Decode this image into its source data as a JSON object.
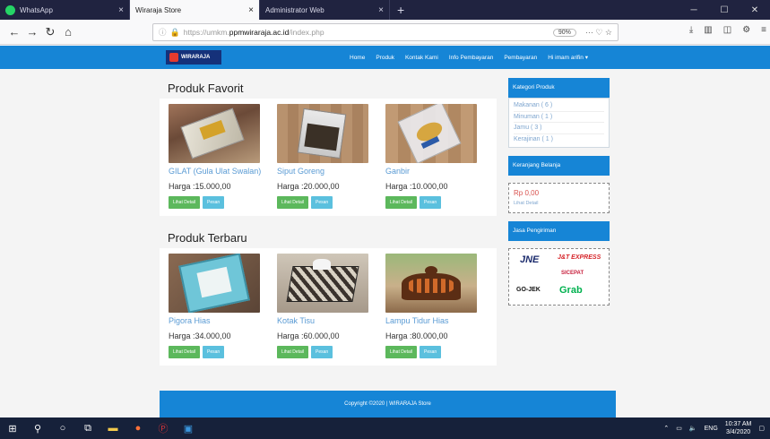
{
  "browser": {
    "tabs": [
      {
        "title": "WhatsApp",
        "active": false,
        "favicon_color": "#25d366"
      },
      {
        "title": "Wiraraja Store",
        "active": true,
        "favicon_color": "#ffffff"
      },
      {
        "title": "Administrator Web",
        "active": false,
        "favicon_color": "#ffffff"
      }
    ],
    "new_tab": "+",
    "url_prefix": "https://umkm.",
    "url_domain": "ppmwiraraja.ac.id",
    "url_path": "/index.php",
    "zoom": "90%",
    "url_actions": "··· ♡ ☆"
  },
  "site": {
    "logo_text": "WIRARAJA",
    "menu": [
      "Home",
      "Produk",
      "Kontak Kami",
      "Info Pembayaran",
      "Pembayaran",
      "Hi imam arifin ▾"
    ]
  },
  "sections": [
    {
      "title": "Produk Favorit",
      "products": [
        {
          "name": "GILAT (Gula Ulat Swalan)",
          "price": "Harga :15.000,00",
          "image": "snack-bag-wood"
        },
        {
          "name": "Siput Goreng",
          "price": "Harga :20.000,00",
          "image": "fried-snail-bag"
        },
        {
          "name": "Ganbir",
          "price": "Harga :10.000,00",
          "image": "ganbir-package"
        }
      ]
    },
    {
      "title": "Produk Terbaru",
      "products": [
        {
          "name": "Pigora Hias",
          "price": "Harga :34.000,00",
          "image": "decorative-frame"
        },
        {
          "name": "Kotak Tisu",
          "price": "Harga :60.000,00",
          "image": "tissue-box"
        },
        {
          "name": "Lampu Tidur Hias",
          "price": "Harga :80.000,00",
          "image": "decorative-lamp"
        }
      ]
    }
  ],
  "buttons": {
    "detail": "Lihat Detail",
    "order": "Pesan"
  },
  "sidebar": {
    "category_title": "Kategori Produk",
    "categories": [
      "Makanan ( 6 )",
      "Minuman ( 1 )",
      "Jamu ( 3 )",
      "Kerajinan ( 1 )"
    ],
    "cart_title": "Keranjang Belanja",
    "cart_total": "Rp 0,00",
    "cart_link": "Lihat Detail",
    "shipping_title": "Jasa Pengiriman",
    "couriers": [
      "JNE",
      "J&T EXPRESS",
      "SICEPAT",
      "GO-JEK",
      "Grab"
    ]
  },
  "footer": "Copyright ©2020 | WIRARAJA Store",
  "taskbar": {
    "lang": "ENG",
    "time": "10:37 AM",
    "date": "3/4/2020"
  },
  "colors": {
    "nav_blue": "#1685d6",
    "tab_dark": "#202340",
    "btn_green": "#5cb85c",
    "btn_blue": "#5bc0de"
  }
}
